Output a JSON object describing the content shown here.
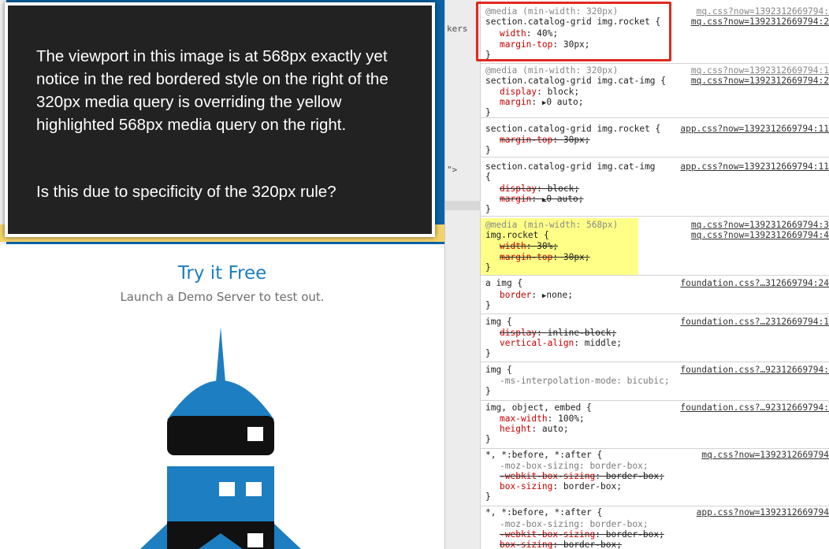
{
  "annotation": {
    "paragraph1": "The viewport in this image is at 568px exactly yet notice in the red bordered style on the right of the 320px media query is overriding the yellow highlighted 568px media query on the right.",
    "paragraph2": "Is this due to specificity of the 320px rule?"
  },
  "page": {
    "title": "Try it Free",
    "subtitle": "Launch a Demo Server to test out."
  },
  "divider": {
    "fragment1": "kers",
    "fragment2": "\">"
  },
  "colors": {
    "accent": "#1d7ec1",
    "highlight": "#ffff88",
    "redbox": "#e02a1e",
    "hero_blue": "#0a63a6",
    "property_red": "#c80000"
  },
  "rules": [
    {
      "media": "@media (min-width: 320px)",
      "selector": "section.catalog-grid img.rocket {",
      "source1": "mq.css?now=1392312669794:",
      "source2": "mq.css?now=1392312669794:2",
      "decls": [
        {
          "p": "width",
          "v": "40%;"
        },
        {
          "p": "margin-top",
          "v": "30px;"
        }
      ],
      "close": "}"
    },
    {
      "media": "@media (min-width: 320px)",
      "selector": "section.catalog-grid img.cat-img {",
      "source1": "mq.css?now=1392312669794:1",
      "source2": "mq.css?now=1392312669794:2",
      "decls": [
        {
          "p": "display",
          "v": "block;"
        },
        {
          "p": "margin",
          "v": "0 auto;"
        }
      ],
      "close": "}"
    },
    {
      "selector": "section.catalog-grid img.rocket {",
      "source": "app.css?now=1392312669794:11",
      "decls": [
        {
          "p": "margin-top",
          "v": "30px;"
        }
      ],
      "close": "}"
    },
    {
      "selector": "section.catalog-grid img.cat-img",
      "open": "{",
      "source": "app.css?now=1392312669794:11",
      "decls": [
        {
          "p": "display",
          "v": "block;"
        },
        {
          "p": "margin",
          "v": "0 auto;"
        }
      ],
      "close": "}"
    },
    {
      "media": "@media (min-width: 568px)",
      "selector": "img.rocket {",
      "source1": "mq.css?now=1392312669794:3",
      "source2": "mq.css?now=1392312669794:4",
      "decls": [
        {
          "p": "width",
          "v": "30%;"
        },
        {
          "p": "margin-top",
          "v": "30px;"
        }
      ],
      "close": "}"
    },
    {
      "selector": "a img {",
      "source": "foundation.css?…312669794:24",
      "decls": [
        {
          "p": "border",
          "v": "none;"
        }
      ],
      "close": "}"
    },
    {
      "selector": "img {",
      "source": "foundation.css?…2312669794:1",
      "decls": [
        {
          "p": "display",
          "v": "inline-block;"
        },
        {
          "p": "vertical-align",
          "v": "middle;"
        }
      ],
      "close": "}"
    },
    {
      "selector": "img {",
      "source": "foundation.css?…92312669794:",
      "decls": [
        {
          "p": "-ms-interpolation-mode",
          "v": "bicubic;"
        }
      ],
      "close": "}"
    },
    {
      "selector": "img, object, embed {",
      "source": "foundation.css?…92312669794:",
      "decls": [
        {
          "p": "max-width",
          "v": "100%;"
        },
        {
          "p": "height",
          "v": "auto;"
        }
      ],
      "close": "}"
    },
    {
      "selector": "*, *:before, *:after {",
      "source": "mq.css?now=1392312669794",
      "decls": [
        {
          "p": "-moz-box-sizing",
          "v": "border-box;"
        },
        {
          "p": "-webkit-box-sizing",
          "v": "border-box;"
        },
        {
          "p": "box-sizing",
          "v": "border-box;"
        }
      ],
      "close": "}"
    },
    {
      "selector": "*, *:before, *:after {",
      "source": "app.css?now=1392312669794",
      "decls": [
        {
          "p": "-moz-box-sizing",
          "v": "border-box;"
        },
        {
          "p": "-webkit-box-sizing",
          "v": "border-box;"
        },
        {
          "p": "box-sizing",
          "v": "border-box;"
        }
      ]
    }
  ]
}
